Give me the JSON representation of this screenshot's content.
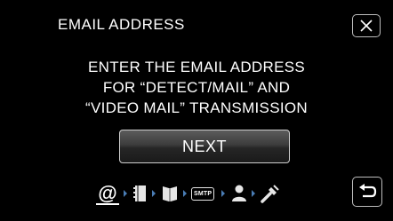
{
  "header": {
    "title": "EMAIL ADDRESS",
    "close_icon": "close-x-icon"
  },
  "message": {
    "lines": [
      "ENTER THE EMAIL ADDRESS",
      "FOR “DETECT/MAIL” AND",
      "“VIDEO MAIL” TRANSMISSION"
    ]
  },
  "next_button": {
    "label": "NEXT"
  },
  "steps": {
    "current": "@",
    "items": [
      "at-icon",
      "notebook-icon",
      "book-icon",
      "smtp-icon",
      "user-icon",
      "wrench-icon"
    ],
    "smtp_label": "SMTP"
  },
  "back_button": {
    "icon": "return-arrow-icon"
  },
  "colors": {
    "background": "#000000",
    "text": "#ffffff",
    "step_arrow": "#4a7db5"
  }
}
